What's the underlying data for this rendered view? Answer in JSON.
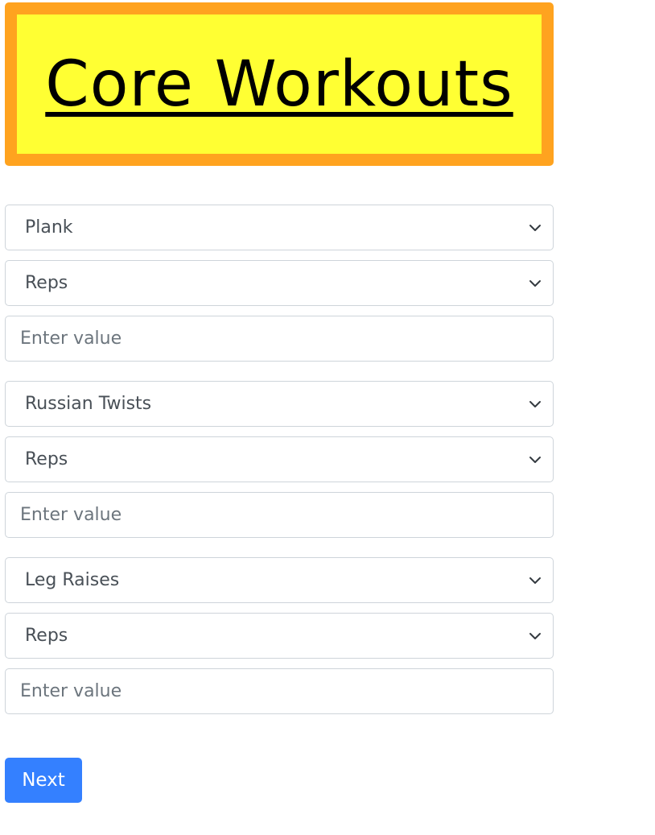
{
  "header": {
    "title": "Core Workouts",
    "background_color": "#ffff33",
    "border_color": "#ffa31f"
  },
  "workouts": [
    {
      "exercise": "Plank",
      "unit": "Reps",
      "value_placeholder": "Enter value",
      "value": ""
    },
    {
      "exercise": "Russian Twists",
      "unit": "Reps",
      "value_placeholder": "Enter value",
      "value": ""
    },
    {
      "exercise": "Leg Raises",
      "unit": "Reps",
      "value_placeholder": "Enter value",
      "value": ""
    }
  ],
  "icons": {
    "select_arrow": "chevron-down-icon"
  },
  "next_button": {
    "label": "Next",
    "color": "#3480ff"
  }
}
